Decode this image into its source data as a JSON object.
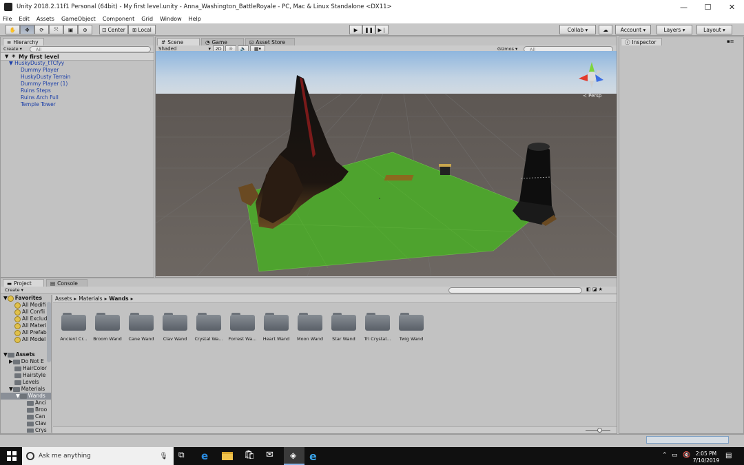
{
  "window": {
    "title": "Unity 2018.2.11f1 Personal (64bit) - My first level.unity - Anna_Washington_BattleRoyale - PC, Mac & Linux Standalone <DX11>",
    "minimize": "—",
    "maximize": "☐",
    "close": "✕"
  },
  "menu": [
    "File",
    "Edit",
    "Assets",
    "GameObject",
    "Component",
    "Grid",
    "Window",
    "Help"
  ],
  "toolbar": {
    "pivot": "Center",
    "space": "Local",
    "collab": "Collab ▾",
    "account": "Account",
    "layers": "Layers",
    "layout": "Layout"
  },
  "hierarchy": {
    "tab": "Hierarchy",
    "create": "Create ▾",
    "search_placeholder": "All",
    "scene_name": "My first level",
    "root": "HuskyDusty_tTCfyy",
    "items": [
      "Dummy Player",
      "HuskyDusty Terrain",
      "Dummy Player (1)",
      "Ruins Steps",
      "Ruins Arch Full",
      "Temple Tower"
    ]
  },
  "scene_view": {
    "tabs": [
      "Scene",
      "Game",
      "Asset Store"
    ],
    "shading": "Shaded",
    "mode_2d": "2D",
    "gizmos": "Gizmos ▾",
    "search_placeholder": "All",
    "persp": "Persp"
  },
  "inspector": {
    "tab": "Inspector"
  },
  "project": {
    "tabs": [
      "Project",
      "Console"
    ],
    "create": "Create ▾",
    "breadcrumb": [
      "Assets",
      "Materials",
      "Wands"
    ],
    "favorites_label": "Favorites",
    "favorites": [
      "All Modifi",
      "All Confli",
      "All Exclud",
      "All Materi",
      "All Prefab",
      "All Model"
    ],
    "assets_label": "Assets",
    "asset_tree": [
      "Do Not E",
      "HairColor",
      "Hairstyle",
      "Levels",
      "Materials",
      "Wands",
      "Anci",
      "Broo",
      "Can",
      "Clav",
      "Crys"
    ],
    "folders": [
      "Ancient Cr...",
      "Broom Wand",
      "Cane Wand",
      "Clav Wand",
      "Crystal Wa...",
      "Forrest Wa...",
      "Heart Wand",
      "Moon Wand",
      "Star Wand",
      "Tri Crystal...",
      "Twig Wand"
    ]
  },
  "taskbar": {
    "search_placeholder": "Ask me anything",
    "time": "2:05 PM",
    "date": "7/10/2019"
  }
}
